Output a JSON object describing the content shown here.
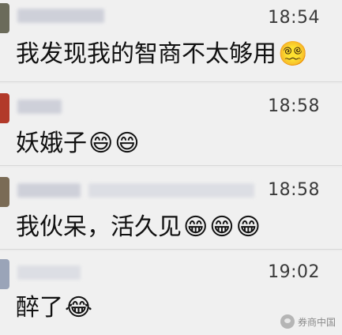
{
  "messages": [
    {
      "time": "18:54",
      "text": "我发现我的智商不太够用",
      "emojis": [
        "😵‍💫"
      ]
    },
    {
      "time": "18:58",
      "text": "妖娥子",
      "emojis": [
        "😄",
        "😄"
      ]
    },
    {
      "time": "18:58",
      "text": "我伙呆，活久见",
      "emojis": [
        "😁",
        "😁",
        "😁"
      ]
    },
    {
      "time": "19:02",
      "text": "醉了",
      "emojis": [
        "😂"
      ]
    }
  ],
  "watermark": {
    "text": "券商中国"
  },
  "colors": {
    "avatar_1": "#6b6b5a",
    "avatar_2": "#b23a2a",
    "avatar_3": "#7a6b55",
    "avatar_4": "#9aa4b8"
  }
}
